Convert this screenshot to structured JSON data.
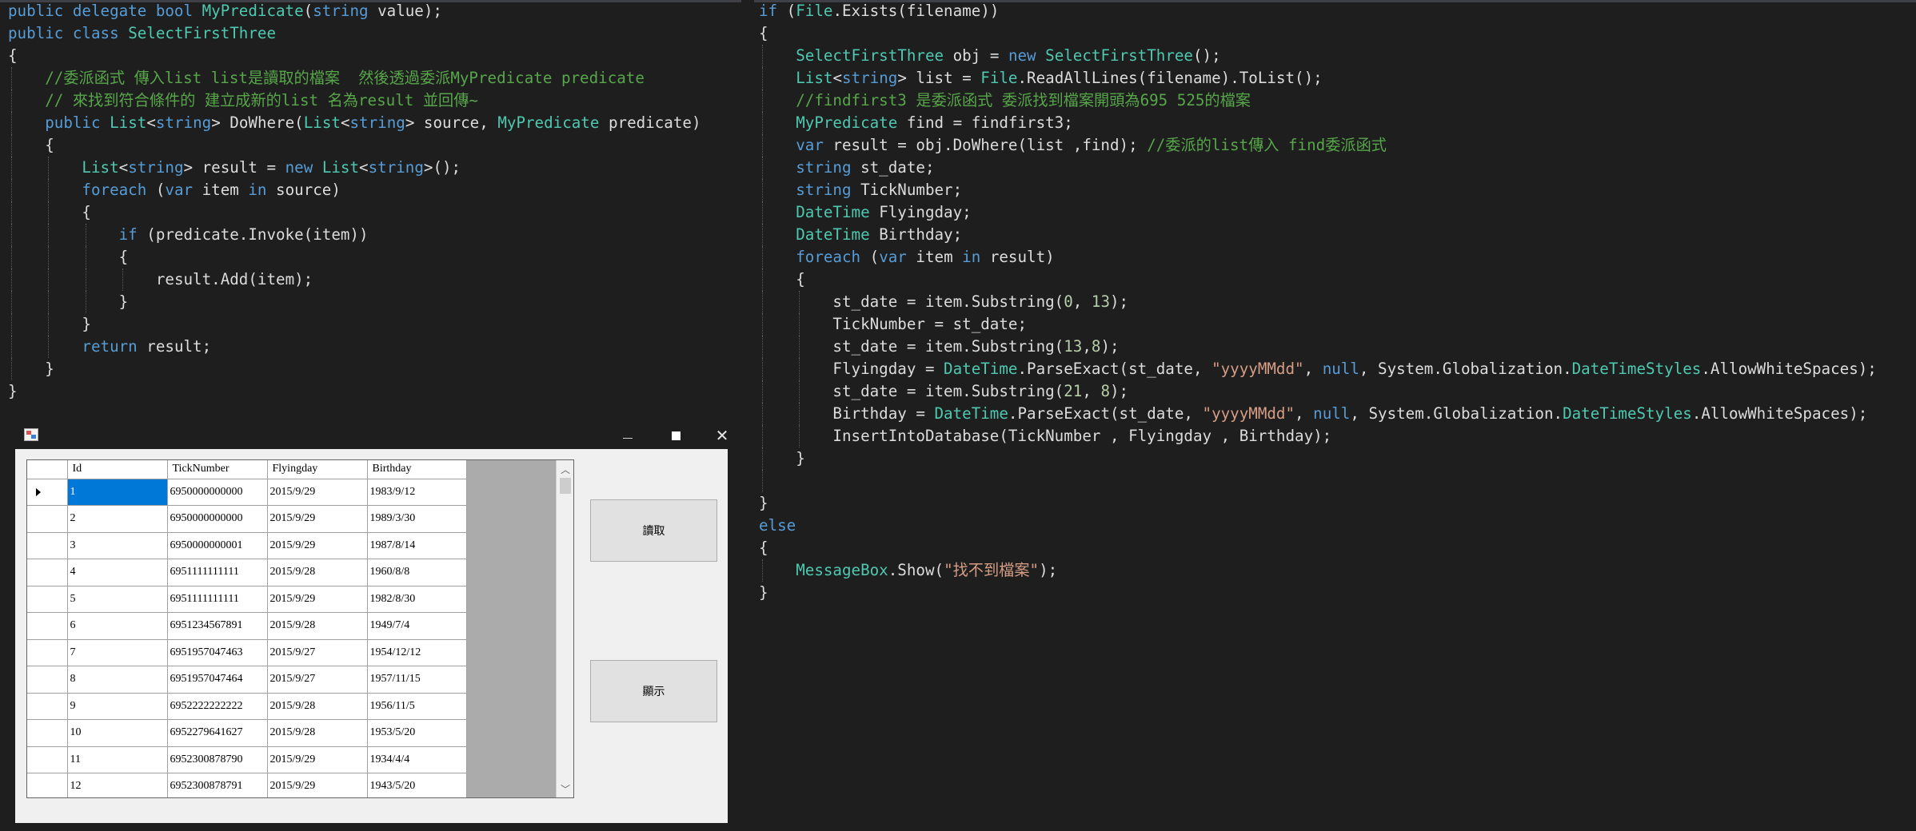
{
  "left_code": [
    {
      "indent": 0,
      "tokens": [
        [
          "kw",
          "public delegate bool "
        ],
        [
          "type",
          "MyPredicate"
        ],
        [
          "txt",
          "("
        ],
        [
          "kw",
          "string"
        ],
        [
          "txt",
          " value);"
        ]
      ]
    },
    {
      "indent": 0,
      "tokens": [
        [
          "kw",
          "public class "
        ],
        [
          "type",
          "SelectFirstThree"
        ]
      ]
    },
    {
      "indent": 0,
      "tokens": [
        [
          "txt",
          "{"
        ]
      ]
    },
    {
      "indent": 1,
      "tokens": [
        [
          "cm",
          "//委派函式 傳入list list是讀取的檔案  然後透過委派MyPredicate predicate"
        ]
      ]
    },
    {
      "indent": 1,
      "tokens": [
        [
          "cm",
          "// 來找到符合條件的 建立成新的list 名為result 並回傳~"
        ]
      ]
    },
    {
      "indent": 1,
      "tokens": [
        [
          "kw",
          "public "
        ],
        [
          "type",
          "List"
        ],
        [
          "txt",
          "<"
        ],
        [
          "kw",
          "string"
        ],
        [
          "txt",
          "> DoWhere("
        ],
        [
          "type",
          "List"
        ],
        [
          "txt",
          "<"
        ],
        [
          "kw",
          "string"
        ],
        [
          "txt",
          "> source, "
        ],
        [
          "type",
          "MyPredicate"
        ],
        [
          "txt",
          " predicate)"
        ]
      ]
    },
    {
      "indent": 1,
      "tokens": [
        [
          "txt",
          "{"
        ]
      ]
    },
    {
      "indent": 2,
      "tokens": [
        [
          "type",
          "List"
        ],
        [
          "txt",
          "<"
        ],
        [
          "kw",
          "string"
        ],
        [
          "txt",
          "> result = "
        ],
        [
          "kw",
          "new "
        ],
        [
          "type",
          "List"
        ],
        [
          "txt",
          "<"
        ],
        [
          "kw",
          "string"
        ],
        [
          "txt",
          ">();"
        ]
      ]
    },
    {
      "indent": 2,
      "tokens": [
        [
          "kw",
          "foreach "
        ],
        [
          "txt",
          "("
        ],
        [
          "kw",
          "var"
        ],
        [
          "txt",
          " item "
        ],
        [
          "kw",
          "in"
        ],
        [
          "txt",
          " source)"
        ]
      ]
    },
    {
      "indent": 2,
      "tokens": [
        [
          "txt",
          "{"
        ]
      ]
    },
    {
      "indent": 3,
      "tokens": [
        [
          "kw",
          "if "
        ],
        [
          "txt",
          "(predicate.Invoke(item))"
        ]
      ]
    },
    {
      "indent": 3,
      "tokens": [
        [
          "txt",
          "{"
        ]
      ]
    },
    {
      "indent": 4,
      "tokens": [
        [
          "txt",
          "result.Add(item);"
        ]
      ]
    },
    {
      "indent": 3,
      "tokens": [
        [
          "txt",
          "}"
        ]
      ]
    },
    {
      "indent": 2,
      "tokens": [
        [
          "txt",
          "}"
        ]
      ]
    },
    {
      "indent": 2,
      "tokens": [
        [
          "kw",
          "return "
        ],
        [
          "txt",
          "result;"
        ]
      ]
    },
    {
      "indent": 1,
      "tokens": [
        [
          "txt",
          "}"
        ]
      ]
    },
    {
      "indent": 0,
      "tokens": [
        [
          "txt",
          "}"
        ]
      ]
    }
  ],
  "right_code": [
    {
      "indent": 0,
      "tokens": [
        [
          "kw",
          "if "
        ],
        [
          "txt",
          "("
        ],
        [
          "type",
          "File"
        ],
        [
          "txt",
          ".Exists(filename))"
        ]
      ]
    },
    {
      "indent": 0,
      "tokens": [
        [
          "txt",
          "{"
        ]
      ]
    },
    {
      "indent": 1,
      "tokens": [
        [
          "type",
          "SelectFirstThree"
        ],
        [
          "txt",
          " obj = "
        ],
        [
          "kw",
          "new "
        ],
        [
          "type",
          "SelectFirstThree"
        ],
        [
          "txt",
          "();"
        ]
      ]
    },
    {
      "indent": 1,
      "tokens": [
        [
          "type",
          "List"
        ],
        [
          "txt",
          "<"
        ],
        [
          "kw",
          "string"
        ],
        [
          "txt",
          "> list = "
        ],
        [
          "type",
          "File"
        ],
        [
          "txt",
          ".ReadAllLines(filename).ToList();"
        ]
      ]
    },
    {
      "indent": 1,
      "tokens": [
        [
          "cm",
          "//findfirst3 是委派函式 委派找到檔案開頭為695 525的檔案"
        ]
      ]
    },
    {
      "indent": 1,
      "tokens": [
        [
          "type",
          "MyPredicate"
        ],
        [
          "txt",
          " find = findfirst3;"
        ]
      ]
    },
    {
      "indent": 1,
      "tokens": [
        [
          "kw",
          "var"
        ],
        [
          "txt",
          " result = obj.DoWhere(list ,find); "
        ],
        [
          "cm",
          "//委派的list傳入 find委派函式"
        ]
      ]
    },
    {
      "indent": 1,
      "tokens": [
        [
          "kw",
          "string"
        ],
        [
          "txt",
          " st_date;"
        ]
      ]
    },
    {
      "indent": 1,
      "tokens": [
        [
          "kw",
          "string"
        ],
        [
          "txt",
          " TickNumber;"
        ]
      ]
    },
    {
      "indent": 1,
      "tokens": [
        [
          "type",
          "DateTime"
        ],
        [
          "txt",
          " Flyingday;"
        ]
      ]
    },
    {
      "indent": 1,
      "tokens": [
        [
          "type",
          "DateTime"
        ],
        [
          "txt",
          " Birthday;"
        ]
      ]
    },
    {
      "indent": 1,
      "tokens": [
        [
          "kw",
          "foreach "
        ],
        [
          "txt",
          "("
        ],
        [
          "kw",
          "var"
        ],
        [
          "txt",
          " item "
        ],
        [
          "kw",
          "in"
        ],
        [
          "txt",
          " result)"
        ]
      ]
    },
    {
      "indent": 1,
      "tokens": [
        [
          "txt",
          "{"
        ]
      ]
    },
    {
      "indent": 2,
      "tokens": [
        [
          "txt",
          "st_date = item.Substring("
        ],
        [
          "num",
          "0"
        ],
        [
          "txt",
          ", "
        ],
        [
          "num",
          "13"
        ],
        [
          "txt",
          ");"
        ]
      ]
    },
    {
      "indent": 2,
      "tokens": [
        [
          "txt",
          "TickNumber = st_date;"
        ]
      ]
    },
    {
      "indent": 2,
      "tokens": [
        [
          "txt",
          "st_date = item.Substring("
        ],
        [
          "num",
          "13"
        ],
        [
          "txt",
          ","
        ],
        [
          "num",
          "8"
        ],
        [
          "txt",
          ");"
        ]
      ]
    },
    {
      "indent": 2,
      "tokens": [
        [
          "txt",
          "Flyingday = "
        ],
        [
          "type",
          "DateTime"
        ],
        [
          "txt",
          ".ParseExact(st_date, "
        ],
        [
          "str",
          "\"yyyyMMdd\""
        ],
        [
          "txt",
          ", "
        ],
        [
          "kw",
          "null"
        ],
        [
          "txt",
          ", System.Globalization."
        ],
        [
          "type",
          "DateTimeStyles"
        ],
        [
          "txt",
          ".AllowWhiteSpaces);"
        ]
      ]
    },
    {
      "indent": 2,
      "tokens": [
        [
          "txt",
          "st_date = item.Substring("
        ],
        [
          "num",
          "21"
        ],
        [
          "txt",
          ", "
        ],
        [
          "num",
          "8"
        ],
        [
          "txt",
          ");"
        ]
      ]
    },
    {
      "indent": 2,
      "tokens": [
        [
          "txt",
          "Birthday = "
        ],
        [
          "type",
          "DateTime"
        ],
        [
          "txt",
          ".ParseExact(st_date, "
        ],
        [
          "str",
          "\"yyyyMMdd\""
        ],
        [
          "txt",
          ", "
        ],
        [
          "kw",
          "null"
        ],
        [
          "txt",
          ", System.Globalization."
        ],
        [
          "type",
          "DateTimeStyles"
        ],
        [
          "txt",
          ".AllowWhiteSpaces);"
        ]
      ]
    },
    {
      "indent": 2,
      "tokens": [
        [
          "txt",
          "InsertIntoDatabase(TickNumber , Flyingday , Birthday);"
        ]
      ]
    },
    {
      "indent": 1,
      "tokens": [
        [
          "txt",
          "}"
        ]
      ]
    },
    {
      "indent": 1,
      "tokens": []
    },
    {
      "indent": 0,
      "tokens": [
        [
          "txt",
          "}"
        ]
      ]
    },
    {
      "indent": 0,
      "tokens": [
        [
          "kw",
          "else"
        ]
      ]
    },
    {
      "indent": 0,
      "tokens": [
        [
          "txt",
          "{"
        ]
      ]
    },
    {
      "indent": 1,
      "tokens": [
        [
          "type",
          "MessageBox"
        ],
        [
          "txt",
          ".Show("
        ],
        [
          "str",
          "\"找不到檔案\""
        ],
        [
          "txt",
          ");"
        ]
      ]
    },
    {
      "indent": 0,
      "tokens": [
        [
          "txt",
          "}"
        ]
      ]
    }
  ],
  "window": {
    "minimize_icon": "minimize-icon",
    "maximize_icon": "maximize-icon",
    "close_symbol": "✕",
    "app_icon": "form-icon"
  },
  "grid": {
    "columns": [
      "Id",
      "TickNumber",
      "Flyingday",
      "Birthday"
    ],
    "rows": [
      [
        "1",
        "6950000000000",
        "2015/9/29",
        "1983/9/12"
      ],
      [
        "2",
        "6950000000000",
        "2015/9/29",
        "1989/3/30"
      ],
      [
        "3",
        "6950000000001",
        "2015/9/29",
        "1987/8/14"
      ],
      [
        "4",
        "6951111111111",
        "2015/9/28",
        "1960/8/8"
      ],
      [
        "5",
        "6951111111111",
        "2015/9/29",
        "1982/8/30"
      ],
      [
        "6",
        "6951234567891",
        "2015/9/28",
        "1949/7/4"
      ],
      [
        "7",
        "6951957047463",
        "2015/9/27",
        "1954/12/12"
      ],
      [
        "8",
        "6951957047464",
        "2015/9/27",
        "1957/11/15"
      ],
      [
        "9",
        "6952222222222",
        "2015/9/28",
        "1956/11/5"
      ],
      [
        "10",
        "6952279641627",
        "2015/9/28",
        "1953/5/20"
      ],
      [
        "11",
        "6952300878790",
        "2015/9/29",
        "1934/4/4"
      ],
      [
        "12",
        "6952300878791",
        "2015/9/29",
        "1943/5/20"
      ]
    ],
    "selected_row": 0,
    "scroll_up": "︿",
    "scroll_down": "﹀"
  },
  "buttons": {
    "read_label": "讀取",
    "show_label": "顯示"
  },
  "colors": {
    "keyword": "#569cd6",
    "type": "#4ec9b0",
    "comment": "#57a64a",
    "string": "#d69d85",
    "selection": "#0078d7"
  }
}
